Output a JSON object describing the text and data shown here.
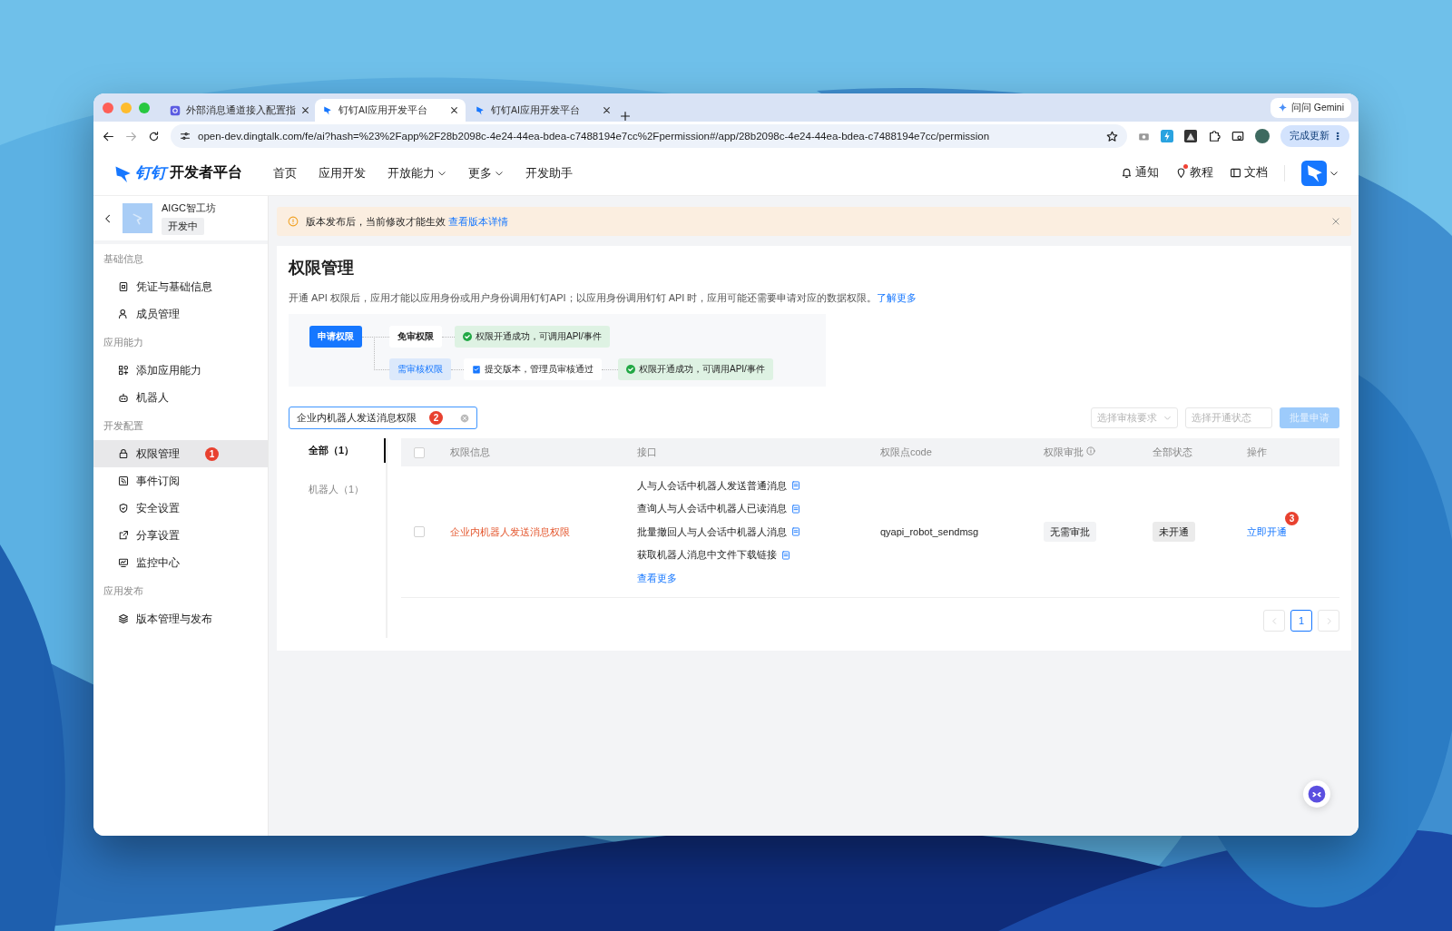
{
  "browser": {
    "tabs": [
      {
        "title": "外部消息通道接入配置指",
        "selected": false
      },
      {
        "title": "钉钉AI应用开发平台",
        "selected": true
      },
      {
        "title": "钉钉AI应用开发平台",
        "selected": false
      }
    ],
    "gemini": "问问 Gemini",
    "url": "open-dev.dingtalk.com/fe/ai?hash=%23%2Fapp%2F28b2098c-4e24-44ea-bdea-c7488194e7cc%2Fpermission#/app/28b2098c-4e24-44ea-bdea-c7488194e7cc/permission",
    "update_button": "完成更新"
  },
  "header": {
    "logo_text": "钉钉",
    "title": "开发者平台",
    "nav": [
      {
        "label": "首页",
        "dropdown": false
      },
      {
        "label": "应用开发",
        "dropdown": false
      },
      {
        "label": "开放能力",
        "dropdown": true
      },
      {
        "label": "更多",
        "dropdown": true
      },
      {
        "label": "开发助手",
        "dropdown": false
      }
    ],
    "actions": [
      {
        "label": "通知",
        "dot": false
      },
      {
        "label": "教程",
        "dot": true
      },
      {
        "label": "文档",
        "dot": false
      }
    ]
  },
  "app": {
    "name": "AIGC智工坊",
    "status": "开发中"
  },
  "sidebar": {
    "sections": [
      {
        "title": "基础信息",
        "items": [
          {
            "label": "凭证与基础信息",
            "selected": false
          },
          {
            "label": "成员管理",
            "selected": false
          }
        ]
      },
      {
        "title": "应用能力",
        "items": [
          {
            "label": "添加应用能力",
            "selected": false
          },
          {
            "label": "机器人",
            "selected": false
          }
        ]
      },
      {
        "title": "开发配置",
        "items": [
          {
            "label": "权限管理",
            "selected": true,
            "badge": "1"
          },
          {
            "label": "事件订阅",
            "selected": false
          },
          {
            "label": "安全设置",
            "selected": false
          },
          {
            "label": "分享设置",
            "selected": false
          },
          {
            "label": "监控中心",
            "selected": false
          }
        ]
      },
      {
        "title": "应用发布",
        "items": [
          {
            "label": "版本管理与发布",
            "selected": false
          }
        ]
      }
    ]
  },
  "notice": {
    "text": "版本发布后，当前修改才能生效",
    "link": "查看版本详情"
  },
  "page": {
    "title": "权限管理",
    "description": "开通 API 权限后，应用才能以应用身份或用户身份调用钉钉API；以应用身份调用钉钉 API 时，应用可能还需要申请对应的数据权限。",
    "link": "了解更多"
  },
  "flow": {
    "start": "申请权限",
    "free": "免审权限",
    "free_result": "权限开通成功，可调用API/事件",
    "review": "需审核权限",
    "review_step": "提交版本，管理员审核通过",
    "review_result": "权限开通成功，可调用API/事件"
  },
  "search": {
    "value": "企业内机器人发送消息权限",
    "badge": "2"
  },
  "filters": [
    {
      "placeholder": "选择审核要求"
    },
    {
      "placeholder": "选择开通状态"
    }
  ],
  "batch_button": {
    "label": "批量申请",
    "disabled": true
  },
  "categories": [
    {
      "label": "全部（1）",
      "selected": true
    },
    {
      "label": "机器人（1）",
      "selected": false
    }
  ],
  "table": {
    "all_checked": false,
    "columns": [
      "权限信息",
      "接口",
      "权限点code",
      "权限审批",
      "全部状态",
      "操作"
    ],
    "rows": [
      {
        "checked": false,
        "name": "企业内机器人发送消息权限",
        "apis": [
          "人与人会话中机器人发送普通消息",
          "查询人与人会话中机器人已读消息",
          "批量撤回人与人会话中机器人消息",
          "获取机器人消息中文件下载链接"
        ],
        "more": "查看更多",
        "code": "qyapi_robot_sendmsg",
        "approval": "无需审批",
        "status": "未开通",
        "action": "立即开通",
        "badge": "3"
      }
    ]
  },
  "pagination": {
    "pages": [
      {
        "label": "1",
        "selected": true
      }
    ]
  }
}
